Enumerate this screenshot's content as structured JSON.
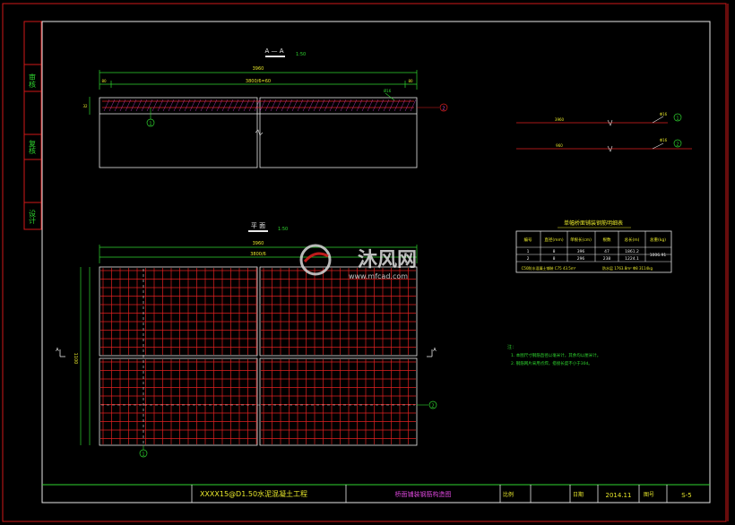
{
  "colors": {
    "background": "#000000",
    "border_red": "#d01818",
    "frame_white": "#e8e8e8",
    "rebar_red": "#e02020",
    "dim_green": "#2fd52f",
    "label_yellow": "#e6e62a",
    "hatch_magenta": "#d846d8"
  },
  "side_strip": {
    "labels": [
      "审核",
      "复核",
      "设计"
    ]
  },
  "section_aa": {
    "title": "A — A",
    "scale": "1:50",
    "overall_dim": "3960",
    "sub_dim": "3800/6=60",
    "left_end_dim": "80",
    "right_end_dim": "80",
    "height_dim": "32",
    "callout_right": "Ø16",
    "bubble_bottom": "1",
    "bubble_right": "2"
  },
  "plan_view": {
    "title": "平 面",
    "scale": "1:50",
    "overall_dim": "3960",
    "sub_dim": "3800/6",
    "left_dims": "1100",
    "section_mark_left": "A",
    "section_mark_right": "A",
    "bubble_bottom": "1",
    "bubble_right": "2"
  },
  "detail_legend": {
    "items": [
      {
        "left_label": "3960",
        "right_label": "Φ16",
        "bubble": "1"
      },
      {
        "left_label": "960",
        "right_label": "Φ16",
        "bubble": "2"
      }
    ]
  },
  "rebar_table": {
    "title": "单幅桥面铺装钢筋明细表",
    "headers": [
      "编号",
      "直径(mm)",
      "单根长(cm)",
      "根数",
      "总长(m)",
      "总重(kg)"
    ],
    "rows": [
      [
        "1",
        "8",
        "396",
        "47",
        "1861.2",
        ""
      ],
      [
        "2",
        "8",
        "296",
        "238",
        "1224.1",
        "1006.91"
      ]
    ],
    "footer": [
      "C50防水混凝土铺装 C75  43.5m³",
      "防水层 1763.8m²  Φ8 3114kg"
    ]
  },
  "notes": {
    "heading": "注：",
    "lines": [
      "1. 本图尺寸钢筋直径以毫米计，其余均以厘米计。",
      "2. 钢筋网片采用点焊，搭接长度不小于30d。"
    ]
  },
  "watermark": {
    "brand": "沐风网",
    "url": "www.mfcad.com"
  },
  "title_block": {
    "project": "XXXX15@D1.50水泥混凝土工程",
    "drawing_name": "桥面铺装钢筋构造图",
    "scale_label": "比例",
    "date_label": "日期",
    "date_value": "2014.11",
    "number_label": "图号",
    "number_value": "S-5"
  }
}
